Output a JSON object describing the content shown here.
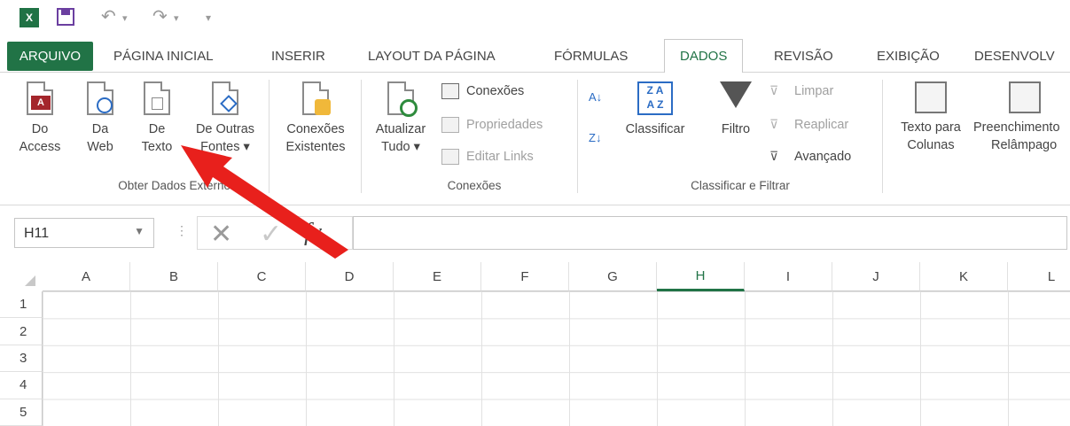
{
  "quick_access": {
    "app_icon": "X",
    "save_icon": "save-icon",
    "undo_icon": "undo-icon",
    "redo_icon": "redo-icon",
    "customize_icon": "customize-qat-icon"
  },
  "tabs": [
    "ARQUIVO",
    "PÁGINA INICIAL",
    "INSERIR",
    "LAYOUT DA PÁGINA",
    "FÓRMULAS",
    "DADOS",
    "REVISÃO",
    "EXIBIÇÃO",
    "DESENVOLV"
  ],
  "active_tab": "DADOS",
  "ribbon": {
    "get_external": {
      "buttons": [
        {
          "line1": "Do",
          "line2": "Access",
          "icon": "access-icon"
        },
        {
          "line1": "Da",
          "line2": "Web",
          "icon": "web-icon"
        },
        {
          "line1": "De",
          "line2": "Texto",
          "icon": "text-file-icon"
        },
        {
          "line1": "De Outras",
          "line2": "Fontes ▾",
          "icon": "other-sources-icon"
        }
      ],
      "label": "Obter Dados Externos"
    },
    "existing": {
      "line1": "Conexões",
      "line2": "Existentes",
      "icon": "existing-connections-icon"
    },
    "connections": {
      "refresh_line1": "Atualizar",
      "refresh_line2": "Tudo ▾",
      "items": [
        "Conexões",
        "Propriedades",
        "Editar Links"
      ],
      "label": "Conexões"
    },
    "sort_filter": {
      "sort": "Classificar",
      "filter": "Filtro",
      "items": [
        "Limpar",
        "Reaplicar",
        "Avançado"
      ],
      "label": "Classificar e Filtrar"
    },
    "data_tools": {
      "text_to_columns_line1": "Texto para",
      "text_to_columns_line2": "Colunas",
      "flash_fill_line1": "Preenchimento",
      "flash_fill_line2": "Relâmpago"
    }
  },
  "formula_bar": {
    "name_box": "H11",
    "cancel": "✕",
    "enter": "✓",
    "fx": "fx",
    "value": ""
  },
  "grid": {
    "columns": [
      "A",
      "B",
      "C",
      "D",
      "E",
      "F",
      "G",
      "H",
      "I",
      "J",
      "K",
      "L"
    ],
    "selected_column": "H",
    "rows": [
      "1",
      "2",
      "3",
      "4",
      "5"
    ]
  },
  "colors": {
    "accent": "#217346",
    "arrow": "#e8201c"
  }
}
